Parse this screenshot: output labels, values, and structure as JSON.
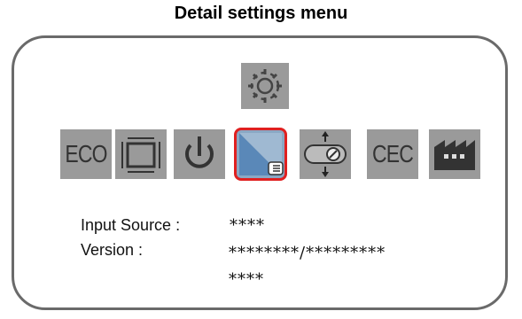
{
  "title": "Detail settings menu",
  "menu_icons": [
    {
      "name": "eco",
      "label": "ECO"
    },
    {
      "name": "screen-size",
      "label": ""
    },
    {
      "name": "power",
      "label": ""
    },
    {
      "name": "detail-settings",
      "label": "",
      "selected": true
    },
    {
      "name": "signal",
      "label": ""
    },
    {
      "name": "cec",
      "label": "CEC"
    },
    {
      "name": "factory",
      "label": ""
    }
  ],
  "info": {
    "input_source_label": "Input Source :",
    "input_source_value": "****",
    "version_label": "Version :",
    "version_value_line1": "********/*********",
    "version_value_line2": "****"
  },
  "colors": {
    "icon_bg": "#9a9a9a",
    "selected_border": "#e02020",
    "selected_bg": "#8aa8c4",
    "panel_border": "#6a6a6a"
  }
}
